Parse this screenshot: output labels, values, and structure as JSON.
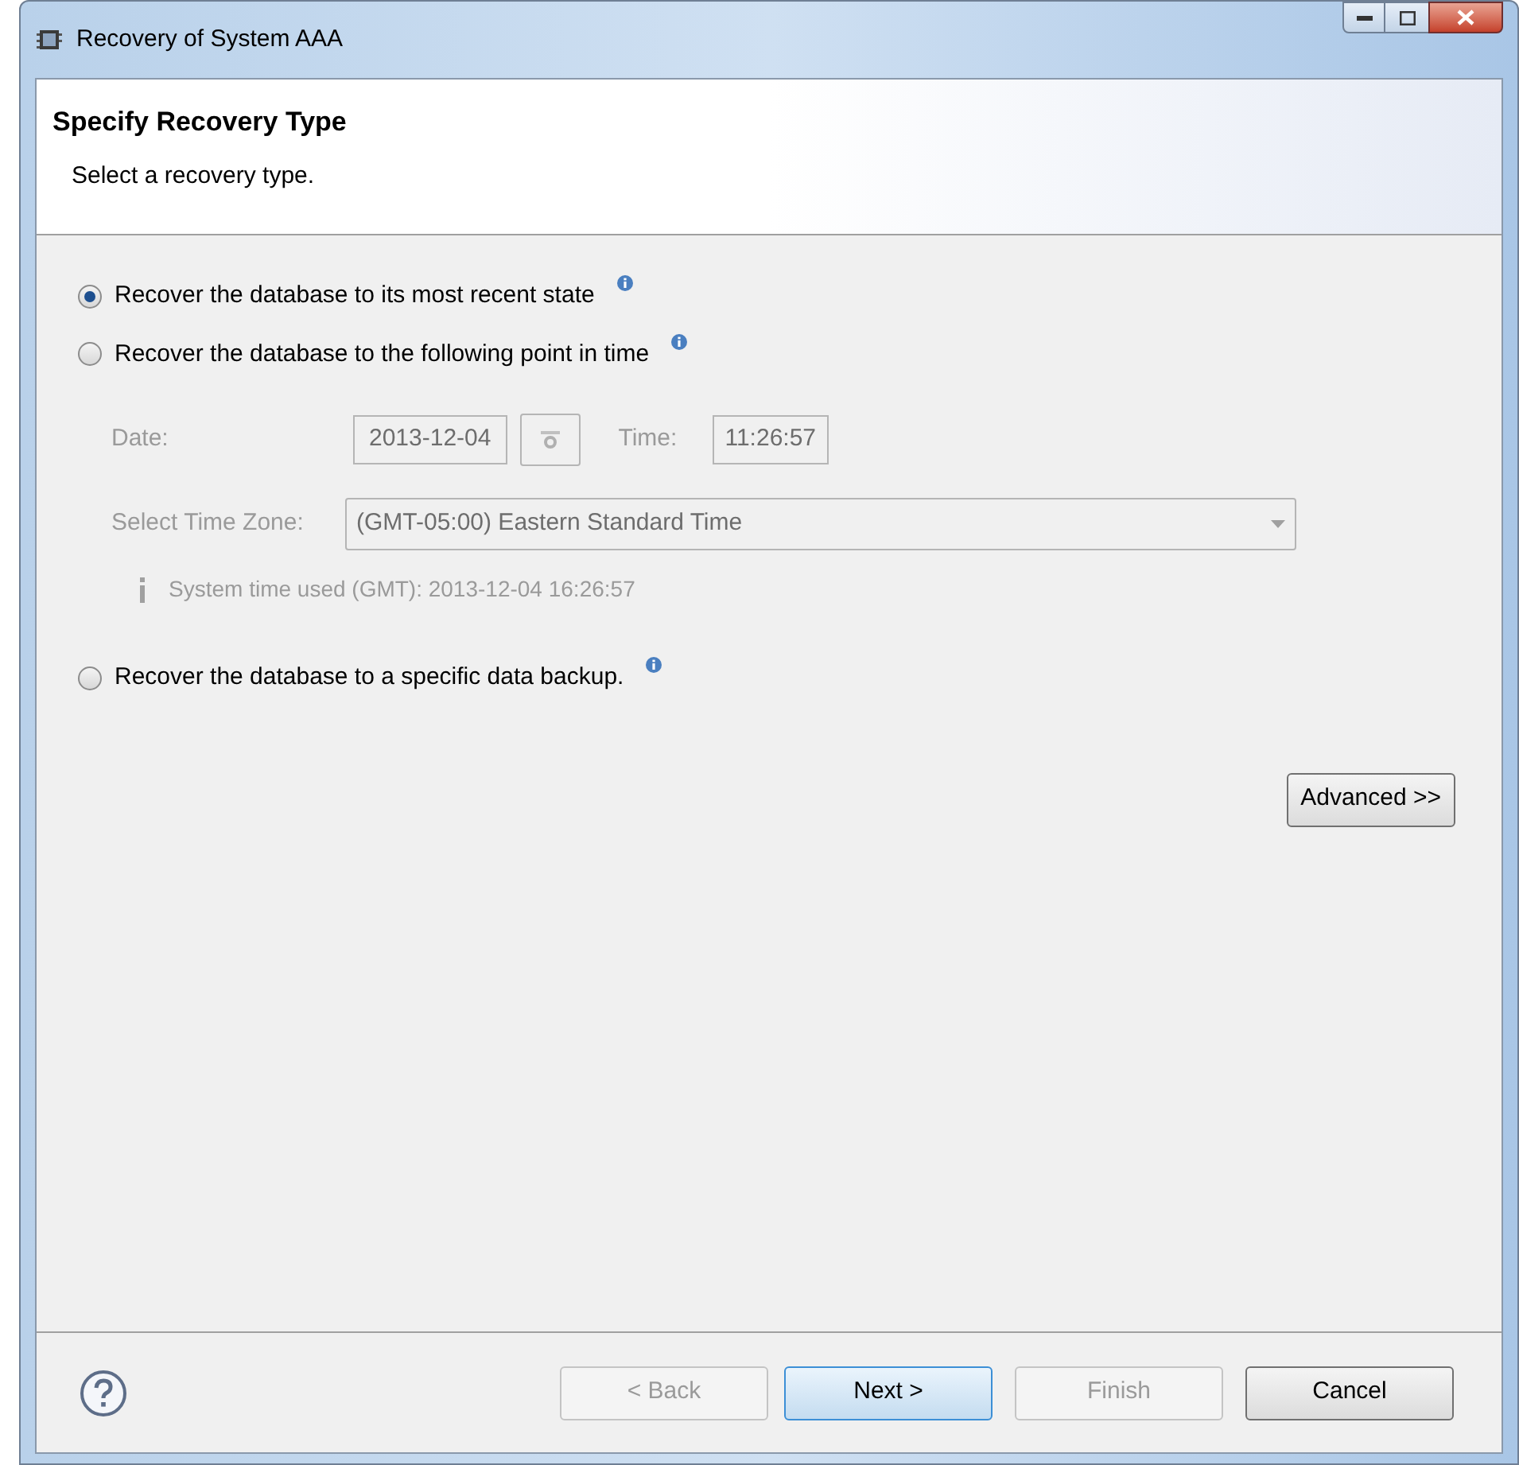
{
  "window": {
    "title": "Recovery of System AAA"
  },
  "header": {
    "title": "Specify Recovery Type",
    "subtitle": "Select a recovery type."
  },
  "options": [
    {
      "label": "Recover the database to its most recent state",
      "selected": true
    },
    {
      "label": "Recover the database to the following point in time",
      "selected": false
    },
    {
      "label": "Recover the database to a specific data backup.",
      "selected": false
    }
  ],
  "point_in_time": {
    "disabled": true,
    "date_label": "Date:",
    "date": "2013-12-04",
    "time_label": "Time:",
    "time": "11:26:57",
    "timezone_label": "Select Time Zone:",
    "timezone": "(GMT-05:00) Eastern Standard Time",
    "note": "System time used (GMT): 2013-12-04 16:26:57"
  },
  "advanced_button": "Advanced >>",
  "buttons": [
    {
      "label": "< Back",
      "disabled": true,
      "default": false
    },
    {
      "label": "Next >",
      "disabled": false,
      "default": true
    },
    {
      "label": "Finish",
      "disabled": true,
      "default": false
    },
    {
      "label": "Cancel",
      "disabled": false,
      "default": false
    }
  ]
}
